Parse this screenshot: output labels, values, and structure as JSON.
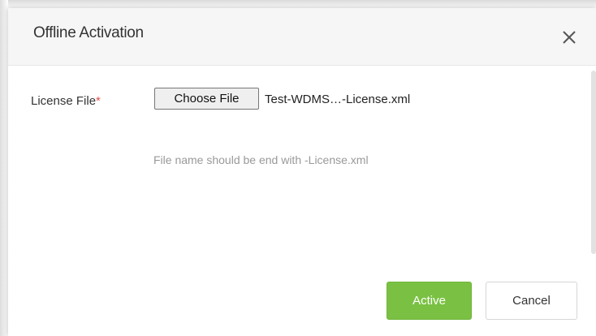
{
  "dialog": {
    "title": "Offline Activation",
    "close_icon": "close-icon"
  },
  "form": {
    "license_label": "License File",
    "required_marker": "*",
    "choose_button_label": "Choose File",
    "selected_file": "Test-WDMS…-License.xml",
    "hint": "File name should be end with -License.xml"
  },
  "footer": {
    "active_label": "Active",
    "cancel_label": "Cancel"
  },
  "colors": {
    "primary_button": "#7ac143",
    "required_marker": "#e05050",
    "hint_text": "#999999"
  }
}
